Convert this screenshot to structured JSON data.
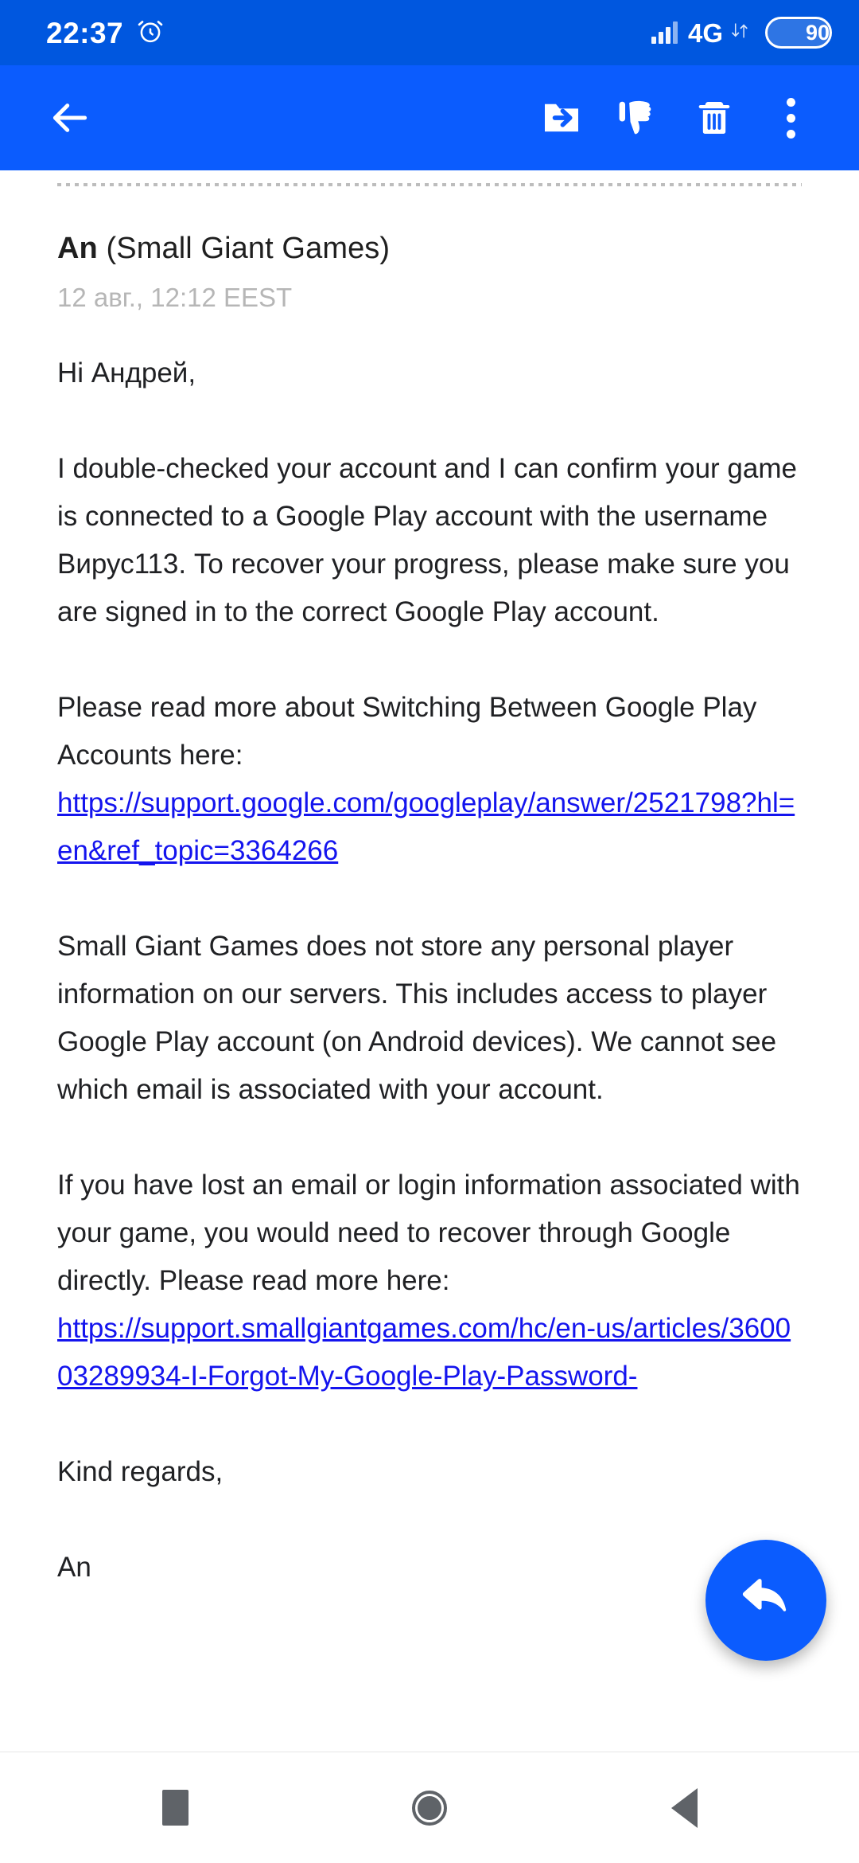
{
  "status_bar": {
    "time": "22:37",
    "alarm_icon": "alarm-clock-icon",
    "signal_icon": "cellular-signal-icon",
    "network_type": "4G",
    "data_arrows_icon": "data-transfer-arrows-icon",
    "battery_percent": "90",
    "background_color": "#0057df"
  },
  "app_bar": {
    "background_color": "#0b5cfe",
    "back_icon": "arrow-left-icon",
    "move_to_folder_icon": "move-to-folder-icon",
    "report_spam_icon": "thumbs-down-icon",
    "delete_icon": "trash-can-icon",
    "overflow_icon": "more-vertical-icon"
  },
  "message": {
    "sender_name": "An",
    "sender_org": " (Small Giant Games)",
    "timestamp": "12 авг., 12:12 EEST",
    "greeting": "Hi Андрей,",
    "paragraph_1": "I double-checked your account and I can confirm your game is connected to a Google Play account with the username Вирус113. To recover your progress, please make sure you are signed in to the correct Google Play account.",
    "paragraph_2_text": "Please read more about Switching Between Google Play Accounts here:",
    "link_1": "https://support.google.com/googleplay/answer/2521798?hl=en&ref_topic=3364266",
    "paragraph_3": "Small Giant Games does not store any personal player information on our servers. This includes access to player Google Play account (on Android devices). We cannot see which email is associated with your account.",
    "paragraph_4_text": "If you have lost an email or login information associated with your game, you would need to recover through Google directly. Please read more here:",
    "link_2": "https://support.smallgiantgames.com/hc/en-us/articles/360003289934-I-Forgot-My-Google-Play-Password-",
    "closing": "Kind regards,",
    "signature": "An",
    "link_color": "#1414ee",
    "text_color": "#202124"
  },
  "fab": {
    "icon": "reply-arrow-icon",
    "background_color": "#0b5cfe"
  },
  "nav_bar": {
    "recents_icon": "square-recents-icon",
    "home_icon": "circle-home-icon",
    "back_icon": "triangle-back-icon"
  }
}
